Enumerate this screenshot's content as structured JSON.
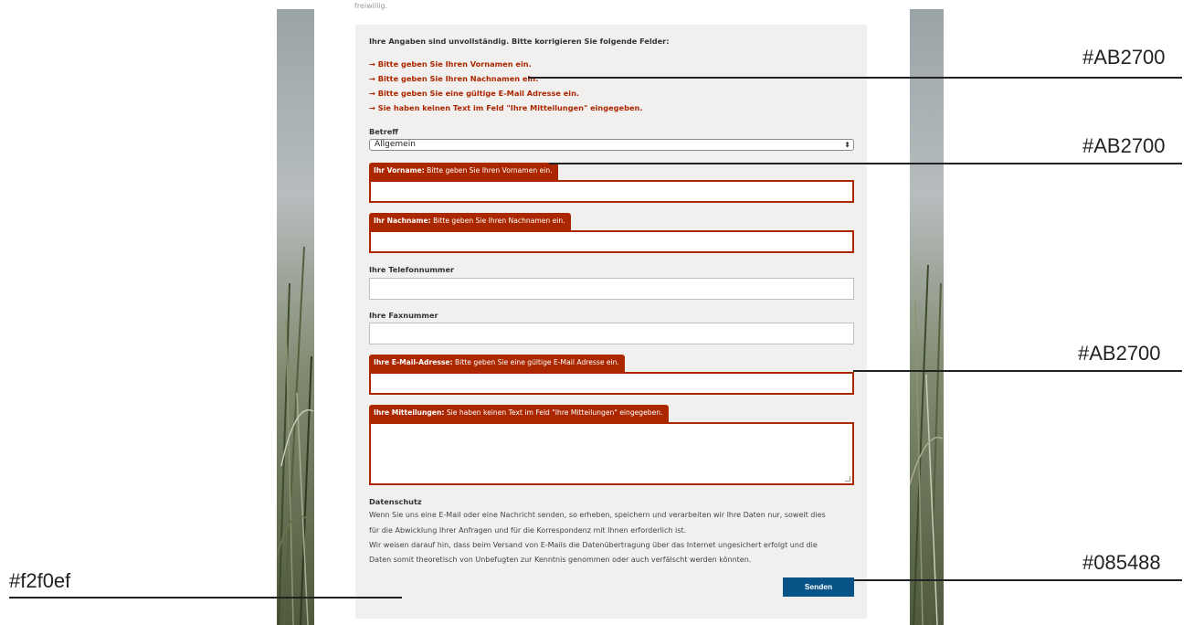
{
  "top_fade_text": "freiwillig.",
  "errors": {
    "heading": "Ihre Angaben sind unvollständig. Bitte korrigieren Sie folgende Felder:",
    "items": [
      "→ Bitte geben Sie Ihren Vornamen ein.",
      "→ Bitte geben Sie Ihren Nachnamen ein.",
      "→ Bitte geben Sie eine gültige E-Mail Adresse ein.",
      "→ Sie haben keinen Text im Feld \"Ihre Mitteilungen\" eingegeben."
    ]
  },
  "form": {
    "subject_label": "Betreff",
    "subject_value": "Allgemein",
    "firstname_label": "Ihr Vorname:",
    "firstname_error": "Bitte geben Sie Ihren Vornamen ein.",
    "lastname_label": "Ihr Nachname:",
    "lastname_error": "Bitte geben Sie Ihren Nachnamen ein.",
    "phone_label": "Ihre Telefonnummer",
    "fax_label": "Ihre Faxnummer",
    "email_label": "Ihre E-Mail-Adresse:",
    "email_error": "Bitte geben Sie eine gültige E-Mail Adresse ein.",
    "message_label": "Ihre Mitteilungen:",
    "message_error": "Sie haben keinen Text im Feld \"Ihre Mitteilungen\" eingegeben."
  },
  "privacy": {
    "title": "Datenschutz",
    "lines": [
      "Wenn Sie uns eine E-Mail oder eine Nachricht senden, so erheben, speichern und verarbeiten wir Ihre Daten nur, soweit dies",
      "für die Abwicklung Ihrer Anfragen und für die Korrespondenz mit Ihnen erforderlich ist.",
      "Wir weisen darauf hin, dass beim Versand von E-Mails die Datenübertragung über das Internet ungesichert erfolgt und die",
      "Daten somit theoretisch von Unbefugten zur Kenntnis genommen oder auch verfälscht werden könnten."
    ]
  },
  "send_label": "Senden",
  "annotations": {
    "error_list_color": "#AB2700",
    "firstname_tag_color": "#AB2700",
    "email_border_color": "#AB2700",
    "button_color": "#085488",
    "panel_color": "#f2f0ef"
  },
  "colors": {
    "error": "#AB2700",
    "button": "#085488",
    "panel": "#f2f0ef"
  }
}
